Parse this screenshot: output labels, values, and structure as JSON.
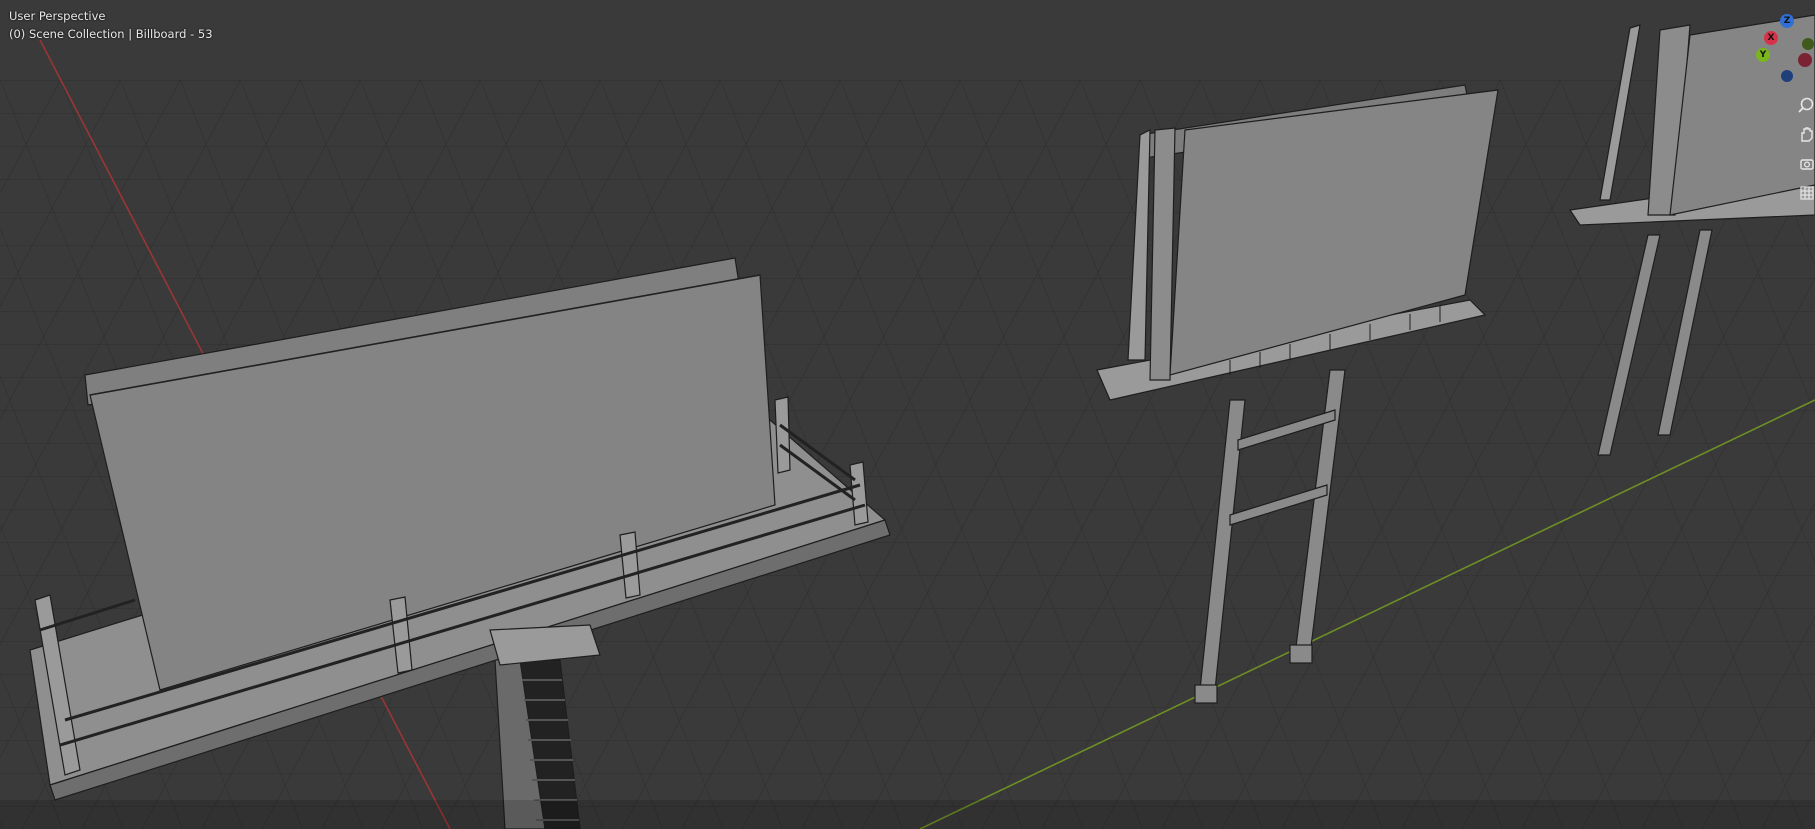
{
  "viewport": {
    "view_name": "User Perspective",
    "collection_line": "(0) Scene Collection | Billboard - 53"
  },
  "gizmo": {
    "axes": [
      {
        "label": "Z",
        "color": "#2f6fd6"
      },
      {
        "label": "X",
        "color": "#d6334a"
      },
      {
        "label": "Y",
        "color": "#7ab51d"
      }
    ]
  },
  "nav_buttons": [
    {
      "name": "zoom-icon"
    },
    {
      "name": "hand-pan-icon"
    },
    {
      "name": "camera-view-icon"
    },
    {
      "name": "grid-ortho-icon"
    }
  ],
  "colors": {
    "background": "#3a3a3a",
    "grid": "#2a2a2a",
    "x_axis": "#b03a3a",
    "y_axis": "#7d9e2a",
    "mesh_fill": "#8a8a8a",
    "mesh_edge": "#1e1e1e"
  }
}
